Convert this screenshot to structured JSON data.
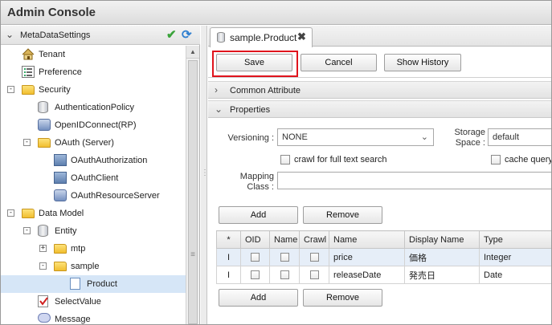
{
  "app": {
    "title": "Admin Console"
  },
  "sidebar": {
    "header": "MetaDataSettings",
    "items": [
      {
        "label": "Tenant",
        "icon": "house-icon"
      },
      {
        "label": "Preference",
        "icon": "list-icon"
      },
      {
        "label": "Security",
        "icon": "folder-icon",
        "expander": "-"
      },
      {
        "label": "AuthenticationPolicy",
        "icon": "cylinder-icon"
      },
      {
        "label": "OpenIDConnect(RP)",
        "icon": "key-icon"
      },
      {
        "label": "OAuth (Server)",
        "icon": "folder-icon",
        "expander": "-"
      },
      {
        "label": "OAuthAuthorization",
        "icon": "computer-icon"
      },
      {
        "label": "OAuthClient",
        "icon": "computer-icon"
      },
      {
        "label": "OAuthResourceServer",
        "icon": "key-icon"
      },
      {
        "label": "Data Model",
        "icon": "folder-icon",
        "expander": "-"
      },
      {
        "label": "Entity",
        "icon": "cylinder-icon",
        "expander": "-"
      },
      {
        "label": "mtp",
        "icon": "folder-icon",
        "expander": "+"
      },
      {
        "label": "sample",
        "icon": "folder-icon",
        "expander": "-"
      },
      {
        "label": "Product",
        "icon": "page-icon"
      },
      {
        "label": "SelectValue",
        "icon": "checklist-icon"
      },
      {
        "label": "Message",
        "icon": "bubble-icon"
      }
    ]
  },
  "tab": {
    "label": "sample.Product",
    "close": "✖"
  },
  "toolbar": {
    "save": "Save",
    "cancel": "Cancel",
    "history": "Show History"
  },
  "sections": {
    "common": "Common Attribute",
    "properties": "Properties"
  },
  "form": {
    "versioning_label": "Versioning :",
    "versioning_value": "NONE",
    "storage_label_1": "Storage",
    "storage_label_2": "Space :",
    "storage_value": "default",
    "crawl_label": "crawl for full text search",
    "cache_label": "cache query",
    "mapping_label_1": "Mapping",
    "mapping_label_2": "Class :",
    "mapping_value": ""
  },
  "grid": {
    "add": "Add",
    "remove": "Remove",
    "columns": [
      "*",
      "OID",
      "Name",
      "Crawl",
      "Name",
      "Display Name",
      "Type"
    ],
    "rows": [
      {
        "marker": "I",
        "name": "price",
        "display": "価格",
        "type": "Integer"
      },
      {
        "marker": "I",
        "name": "releaseDate",
        "display": "発売日",
        "type": "Date"
      }
    ]
  }
}
